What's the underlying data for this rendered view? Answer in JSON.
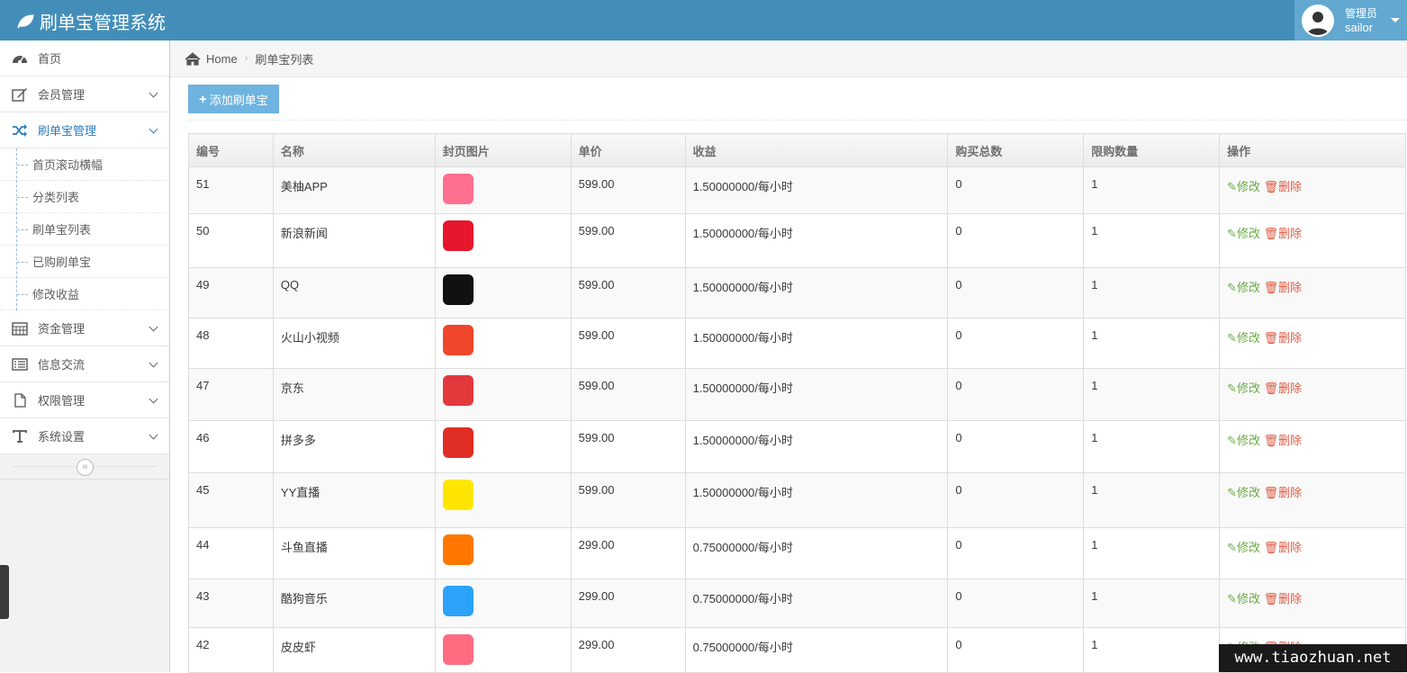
{
  "app": {
    "title": "刷单宝管理系统"
  },
  "user": {
    "role": "管理员",
    "name": "sailor"
  },
  "sidebar": {
    "items": [
      {
        "label": "首页",
        "icon": "dashboard-icon"
      },
      {
        "label": "会员管理",
        "icon": "edit-icon"
      },
      {
        "label": "刷单宝管理",
        "icon": "random-icon"
      },
      {
        "label": "资金管理",
        "icon": "calendar-icon"
      },
      {
        "label": "信息交流",
        "icon": "list-icon"
      },
      {
        "label": "权限管理",
        "icon": "file-icon"
      },
      {
        "label": "系统设置",
        "icon": "text-icon"
      }
    ],
    "submenu": [
      "首页滚动横幅",
      "分类列表",
      "刷单宝列表",
      "已购刷单宝",
      "修改收益"
    ],
    "collapse_glyph": "«"
  },
  "breadcrumb": {
    "home": "Home",
    "current": "刷单宝列表"
  },
  "toolbar": {
    "add_label": "添加刷单宝"
  },
  "table": {
    "headers": [
      "编号",
      "名称",
      "封页图片",
      "单价",
      "收益",
      "购买总数",
      "限购数量",
      "操作"
    ],
    "edit_label": "修改",
    "delete_label": "删除",
    "rows": [
      {
        "id": "51",
        "name": "美柚APP",
        "price": "599.00",
        "income": "1.50000000/每小时",
        "total": "0",
        "limit": "1",
        "logo_color": "#ff6f8f"
      },
      {
        "id": "50",
        "name": "新浪新闻",
        "price": "599.00",
        "income": "1.50000000/每小时",
        "total": "0",
        "limit": "1",
        "logo_color": "#e6162d"
      },
      {
        "id": "49",
        "name": "QQ",
        "price": "599.00",
        "income": "1.50000000/每小时",
        "total": "0",
        "limit": "1",
        "logo_color": "#111111"
      },
      {
        "id": "48",
        "name": "火山小视频",
        "price": "599.00",
        "income": "1.50000000/每小时",
        "total": "0",
        "limit": "1",
        "logo_color": "#f0462c"
      },
      {
        "id": "47",
        "name": "京东",
        "price": "599.00",
        "income": "1.50000000/每小时",
        "total": "0",
        "limit": "1",
        "logo_color": "#e4393c"
      },
      {
        "id": "46",
        "name": "拼多多",
        "price": "599.00",
        "income": "1.50000000/每小时",
        "total": "0",
        "limit": "1",
        "logo_color": "#e02e24"
      },
      {
        "id": "45",
        "name": "YY直播",
        "price": "599.00",
        "income": "1.50000000/每小时",
        "total": "0",
        "limit": "1",
        "logo_color": "#ffe600"
      },
      {
        "id": "44",
        "name": "斗鱼直播",
        "price": "299.00",
        "income": "0.75000000/每小时",
        "total": "0",
        "limit": "1",
        "logo_color": "#ff7700"
      },
      {
        "id": "43",
        "name": "酷狗音乐",
        "price": "299.00",
        "income": "0.75000000/每小时",
        "total": "0",
        "limit": "1",
        "logo_color": "#2ca2f9"
      },
      {
        "id": "42",
        "name": "皮皮虾",
        "price": "299.00",
        "income": "0.75000000/每小时",
        "total": "0",
        "limit": "1",
        "logo_color": "#ff6b81"
      }
    ]
  },
  "watermark": "www.tiaozhuan.net"
}
